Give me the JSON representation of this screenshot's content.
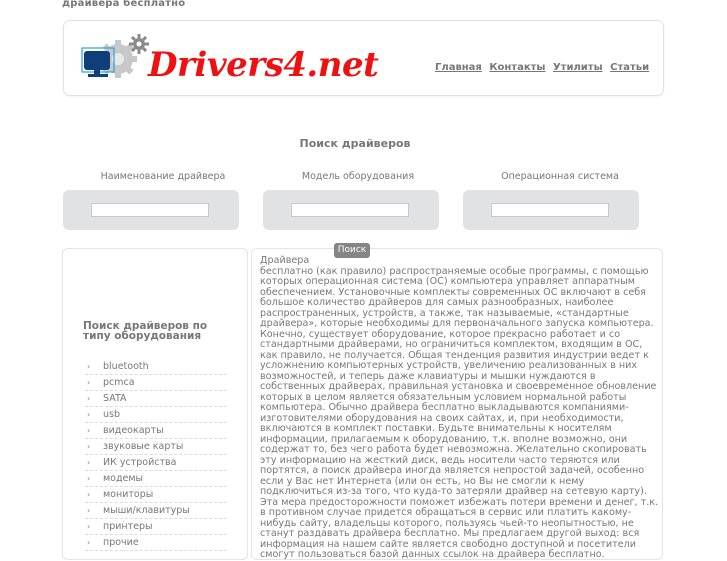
{
  "page": {
    "top_title": "драйвера бесплатно"
  },
  "header": {
    "logo_text": "Drivers4.net",
    "nav": [
      {
        "label": "Главная"
      },
      {
        "label": "Контакты"
      },
      {
        "label": "Утилиты"
      },
      {
        "label": "Статьи"
      }
    ]
  },
  "search": {
    "title": "Поиск драйверов",
    "fields": [
      {
        "label": "Наименование драйвера",
        "value": "",
        "placeholder": ""
      },
      {
        "label": "Модель оборудования",
        "value": "",
        "placeholder": ""
      },
      {
        "label": "Операционная система",
        "value": "",
        "placeholder": ""
      }
    ],
    "button_label": "Поиск"
  },
  "sidebar": {
    "title": "Поиск драйверов по типу оборудования",
    "items": [
      {
        "label": "bluetooth"
      },
      {
        "label": "pcmca"
      },
      {
        "label": "SATA"
      },
      {
        "label": "usb"
      },
      {
        "label": "видеокарты"
      },
      {
        "label": "звуковые карты"
      },
      {
        "label": "ИК устройства"
      },
      {
        "label": "модемы"
      },
      {
        "label": "мониторы"
      },
      {
        "label": "мыши/клавитуры"
      },
      {
        "label": "принтеры"
      },
      {
        "label": "прочие"
      }
    ],
    "arrow_glyph": "›"
  },
  "content": {
    "heading": "Драйвера",
    "body": "бесплатно (как правило) распространяемые особые программы, с помощью которых операционная система (ОС) компьютера управляет аппаратным обеспечением. Установочные комплекты современных ОС включают в себя большое количество драйверов для самых разнообразных, наиболее распространенных, устройств, а также, так называемые, «стандартные драйвера», которые необходимы для первоначального запуска компьютера. Конечно, существует оборудование, которое прекрасно работает и со стандартными драйверами, но ограничиться комплектом, входящим в ОС, как правило, не получается. Общая тенденция развития индустрии ведет к усложнению компьютерных устройств, увеличению реализованных в них возможностей, и теперь даже клавиатуры и мышки нуждаются в собственных драйверах, правильная установка и своевременное обновление которых в целом является обязательным условием нормальной работы компьютера. Обычно драйвера бесплатно выкладываются компаниями-изготовителями оборудования на своих сайтах, и, при необходимости, включаются в комплект поставки. Будьте внимательны к носителям информации, прилагаемым к оборудованию, т.к. вполне возможно, они содержат то, без чего работа будет невозможна. Желательно скопировать эту информацию на жесткий диск, ведь носители часто теряются или портятся, а поиск драйвера иногда является непростой задачей, особенно если у Вас нет Интернета (или он есть, но Вы не смогли к нему подключиться из-за того, что куда-то затеряли драйвер на сетевую карту). Эта мера предосторожности поможет избежать потери времени и денег, т.к. в противном случае придется обращаться в сервис или платить какому-нибудь сайту, владельцы которого, пользуясь чьей-то неопытностью, не станут раздавать драйвера бесплатно. Мы предлагаем другой выход: вся информация на нашем сайте является свободно доступной и посетители смогут пользоваться базой данных ссылок на драйвера бесплатно."
  },
  "colors": {
    "logo_red": "#ee1111",
    "monitor_blue": "#0e3f78",
    "gear_gray": "#c8c8c8",
    "field_bg": "#e1e2e3",
    "button_bg": "#858585"
  }
}
